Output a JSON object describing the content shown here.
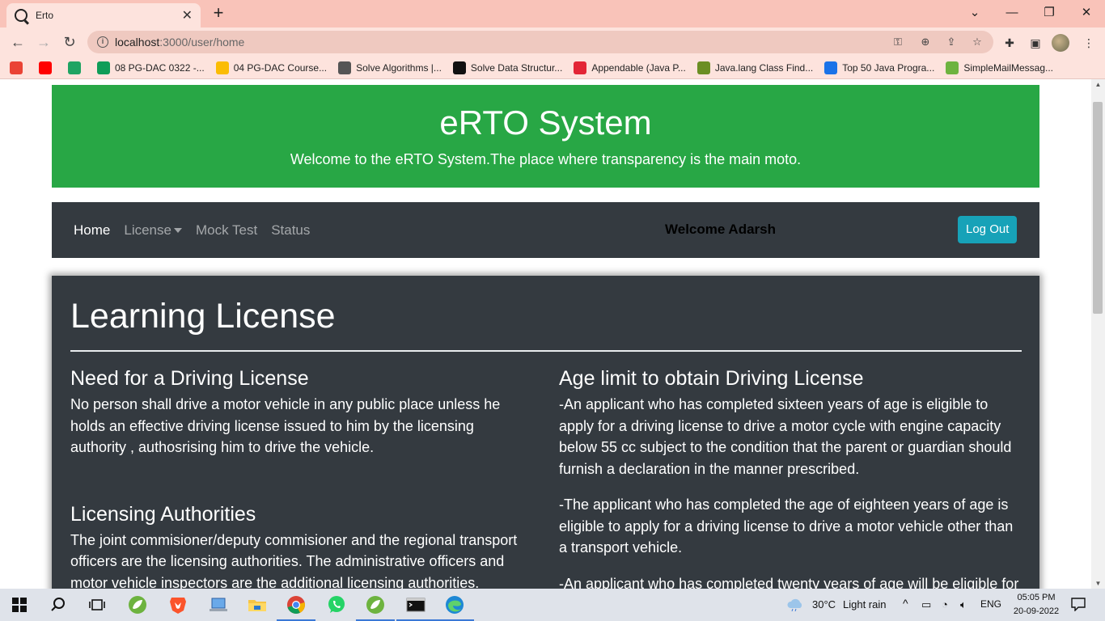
{
  "browser": {
    "tab_title": "Erto",
    "tab_close": "✕",
    "new_tab": "+",
    "url_host": "localhost",
    "url_path": ":3000/user/home",
    "window_controls": [
      "chevron-down",
      "minimize",
      "restore",
      "close"
    ],
    "bookmarks": [
      {
        "label": "",
        "icon": "gmail-icon",
        "color": "#ea4335"
      },
      {
        "label": "",
        "icon": "youtube-icon",
        "color": "#ff0000"
      },
      {
        "label": "",
        "icon": "drive-icon",
        "color": "#1fa463"
      },
      {
        "label": "08 PG-DAC 0322 -...",
        "icon": "sheets-icon",
        "color": "#0f9d58"
      },
      {
        "label": "04 PG-DAC Course...",
        "icon": "drive-icon",
        "color": "#fbbc04"
      },
      {
        "label": "Solve Algorithms |...",
        "icon": "hackerrank-icon",
        "color": "#555555"
      },
      {
        "label": "Solve Data Structur...",
        "icon": "hackerrank-h-icon",
        "color": "#111111"
      },
      {
        "label": "Appendable (Java P...",
        "icon": "oracle-icon",
        "color": "#e32636"
      },
      {
        "label": "Java.lang Class Find...",
        "icon": "plant-icon",
        "color": "#6b8e23"
      },
      {
        "label": "Top 50 Java Progra...",
        "icon": "loop-icon",
        "color": "#1a73e8"
      },
      {
        "label": "SimpleMailMessag...",
        "icon": "spring-icon",
        "color": "#6db33f"
      }
    ]
  },
  "header": {
    "title": "eRTO System",
    "subtitle": "Welcome to the eRTO System.The place where transparency is the main moto."
  },
  "nav": {
    "home": "Home",
    "license": "License",
    "mock_test": "Mock Test",
    "status": "Status",
    "welcome": "Welcome Adarsh",
    "logout": "Log Out"
  },
  "card": {
    "title": "Learning License",
    "left": [
      {
        "heading": "Need for a Driving License",
        "text": "No person shall drive a motor vehicle in any public place unless he holds an effective driving license issued to him by the licensing authority , authosrising him to drive the vehicle."
      },
      {
        "heading": "Licensing Authorities",
        "text": "The joint commisioner/deputy commisioner and the regional transport officers are the licensing authorities. The administrative officers and motor vehicle inspectors are the additional licensing authorities."
      }
    ],
    "right_heading": "Age limit to obtain Driving License",
    "right": [
      "-An applicant who has completed sixteen years of age is eligible to apply for a driving license to drive a motor cycle with engine capacity below 55 cc subject to the condition that the parent or guardian should furnish a declaration in the manner prescribed.",
      "-The applicant who has completed the age of eighteen years of age is eligible to apply for a driving license to drive a motor vehicle other than a transport vehicle.",
      "-An applicant who has completed twenty years of age will be eligible for"
    ]
  },
  "taskbar": {
    "weather_temp": "30°C",
    "weather_desc": "Light rain",
    "lang": "ENG",
    "time": "05:05 PM",
    "date": "20-09-2022"
  }
}
